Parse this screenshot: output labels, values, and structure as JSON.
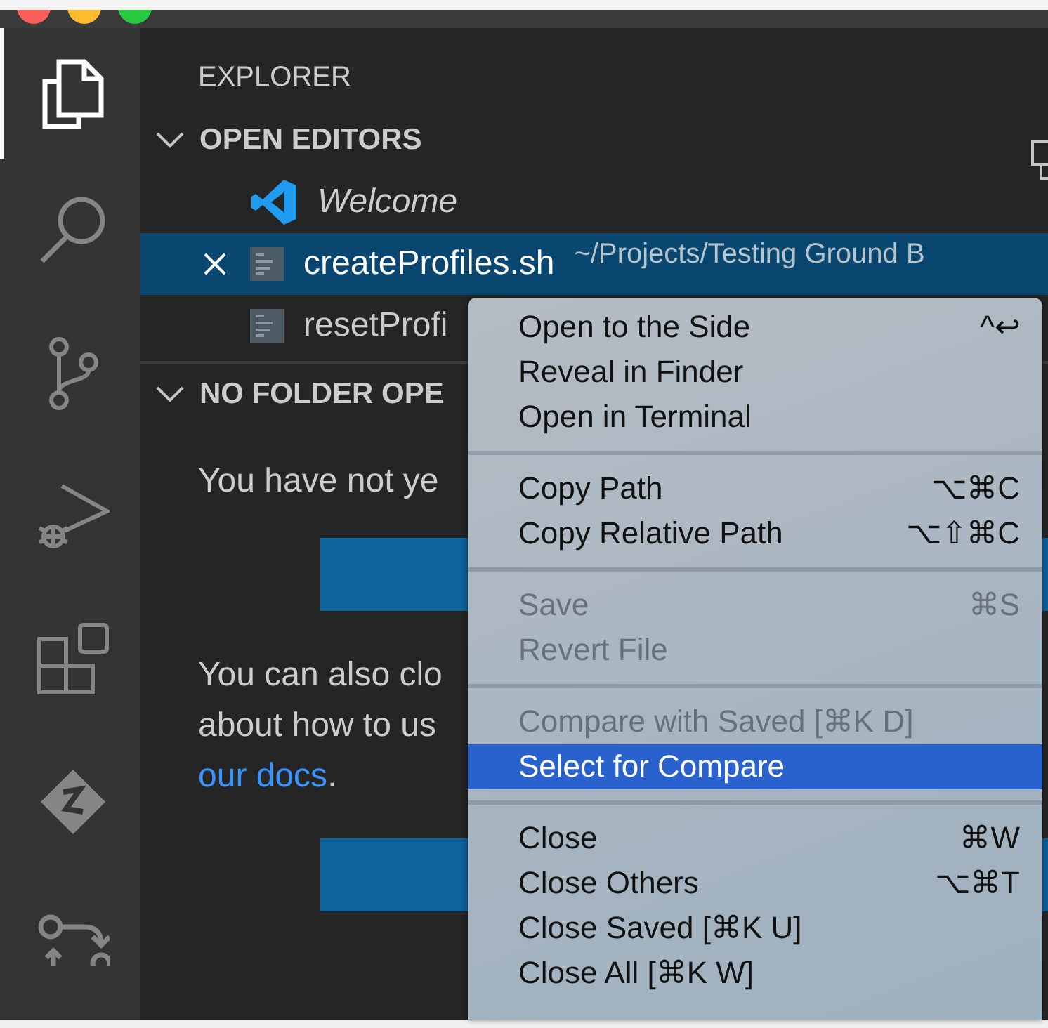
{
  "activity_bar": [
    {
      "kind": "files",
      "selected": true
    },
    {
      "kind": "search",
      "selected": false
    },
    {
      "kind": "source-control",
      "selected": false
    },
    {
      "kind": "debug",
      "selected": false
    },
    {
      "kind": "extensions",
      "selected": false
    },
    {
      "kind": "zdiamond",
      "selected": false
    },
    {
      "kind": "flow",
      "selected": false
    }
  ],
  "sidebar": {
    "title": "EXPLORER",
    "open_editors": {
      "title": "OPEN EDITORS",
      "expanded": true,
      "items": [
        {
          "kind": "vscode",
          "name": "Welcome",
          "italic": true,
          "selected": false
        },
        {
          "kind": "file",
          "name": "createProfiles.sh",
          "path": "~/Projects/Testing Ground B",
          "selected": true
        },
        {
          "kind": "file",
          "name": "resetProfi",
          "selected": false
        }
      ]
    },
    "no_folder": {
      "title": "NO FOLDER OPE",
      "expanded": true,
      "text_1": "You have not ye",
      "text_2_lines": [
        "You can also clo",
        "about how to us"
      ],
      "link": "our docs",
      "link_after": "."
    }
  },
  "context_menu": {
    "groups": [
      [
        {
          "label": "Open to the Side",
          "shortcut": "^↩",
          "disabled": false,
          "selected": false
        },
        {
          "label": "Reveal in Finder",
          "disabled": false,
          "selected": false
        },
        {
          "label": "Open in Terminal",
          "disabled": false,
          "selected": false
        }
      ],
      [
        {
          "label": "Copy Path",
          "shortcut": "⌥⌘C",
          "disabled": false,
          "selected": false
        },
        {
          "label": "Copy Relative Path",
          "shortcut": "⌥⇧⌘C",
          "disabled": false,
          "selected": false
        }
      ],
      [
        {
          "label": "Save",
          "shortcut": "⌘S",
          "disabled": true,
          "selected": false
        },
        {
          "label": "Revert File",
          "disabled": true,
          "selected": false
        }
      ],
      [
        {
          "label": "Compare with Saved [⌘K D]",
          "disabled": true,
          "selected": false
        },
        {
          "label": "Select for Compare",
          "disabled": false,
          "selected": true
        }
      ],
      [
        {
          "label": "Close",
          "shortcut": "⌘W",
          "disabled": false,
          "selected": false
        },
        {
          "label": "Close Others",
          "shortcut": "⌥⌘T",
          "disabled": false,
          "selected": false
        },
        {
          "label": "Close Saved [⌘K U]",
          "disabled": false,
          "selected": false
        },
        {
          "label": "Close All [⌘K W]",
          "disabled": false,
          "selected": false
        }
      ]
    ]
  }
}
